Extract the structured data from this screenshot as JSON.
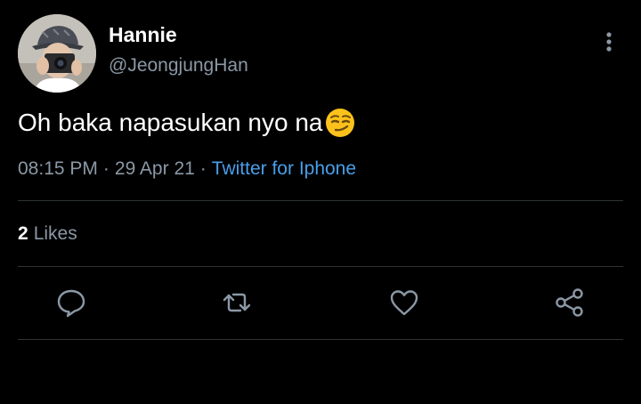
{
  "user": {
    "display_name": "Hannie",
    "handle": "@JeongjungHan"
  },
  "tweet": {
    "text": "Oh baka napasukan nyo na",
    "emoji_icon": "smirking-face-emoji",
    "time": "08:15 PM",
    "date": "29 Apr 21",
    "separator": "·",
    "source": "Twitter for Iphone"
  },
  "stats": {
    "likes_count": "2",
    "likes_label": "Likes"
  },
  "actions": {
    "reply_icon": "reply-icon",
    "retweet_icon": "retweet-icon",
    "like_icon": "heart-icon",
    "share_icon": "share-icon"
  },
  "colors": {
    "background": "#000000",
    "text": "#ffffff",
    "secondary": "#8b98a5",
    "link": "#4a9ee8",
    "divider": "#2f3336"
  }
}
